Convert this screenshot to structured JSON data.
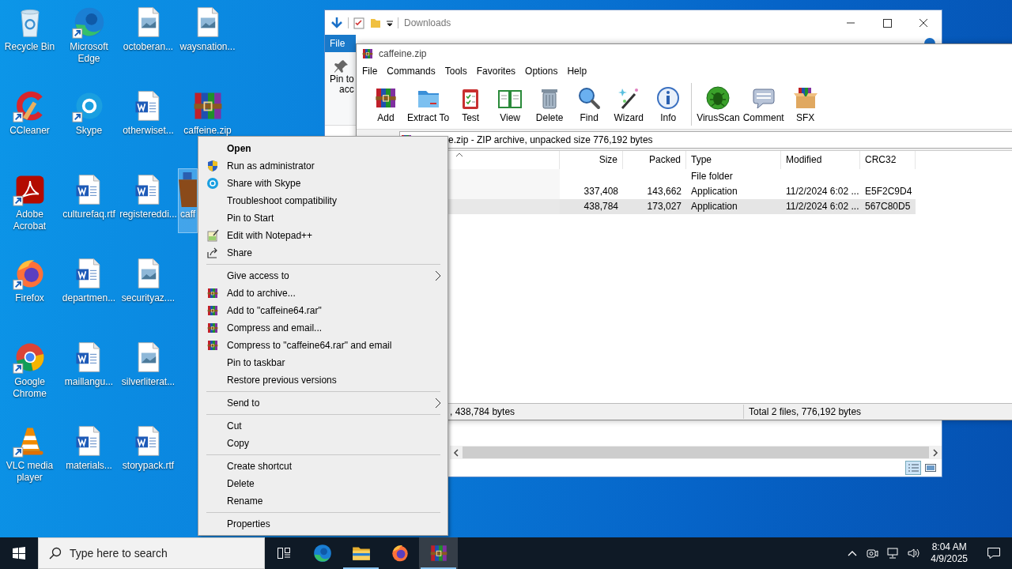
{
  "desktop_icons": [
    {
      "label": "Recycle Bin",
      "kind": "recycle",
      "shortcut": false,
      "selected": false
    },
    {
      "label": "CCleaner",
      "kind": "ccleaner",
      "shortcut": true,
      "selected": false
    },
    {
      "label": "Adobe Acrobat",
      "kind": "acrobat",
      "shortcut": true,
      "selected": false
    },
    {
      "label": "Firefox",
      "kind": "firefox",
      "shortcut": true,
      "selected": false
    },
    {
      "label": "Google Chrome",
      "kind": "chrome",
      "shortcut": true,
      "selected": false
    },
    {
      "label": "VLC media player",
      "kind": "vlc",
      "shortcut": true,
      "selected": false
    },
    {
      "label": "Microsoft Edge",
      "kind": "edge",
      "shortcut": true,
      "selected": false
    },
    {
      "label": "Skype",
      "kind": "skype",
      "shortcut": true,
      "selected": false
    },
    {
      "label": "culturefaq.rtf",
      "kind": "word",
      "shortcut": false,
      "selected": false
    },
    {
      "label": "departmen...",
      "kind": "word",
      "shortcut": false,
      "selected": false
    },
    {
      "label": "maillangu...",
      "kind": "word",
      "shortcut": false,
      "selected": false
    },
    {
      "label": "materials...",
      "kind": "word",
      "shortcut": false,
      "selected": false
    },
    {
      "label": "octoberan...",
      "kind": "image",
      "shortcut": false,
      "selected": false
    },
    {
      "label": "otherwiset...",
      "kind": "word",
      "shortcut": false,
      "selected": false
    },
    {
      "label": "registereddi...",
      "kind": "word",
      "shortcut": false,
      "selected": false
    },
    {
      "label": "securityaz....",
      "kind": "image",
      "shortcut": false,
      "selected": false
    },
    {
      "label": "silverliterat...",
      "kind": "image",
      "shortcut": false,
      "selected": false
    },
    {
      "label": "storypack.rtf",
      "kind": "word",
      "shortcut": false,
      "selected": false
    },
    {
      "label": "waysnation...",
      "kind": "image",
      "shortcut": false,
      "selected": false
    },
    {
      "label": "caffeine.zip",
      "kind": "archive",
      "shortcut": false,
      "selected": false
    },
    {
      "label": "caff",
      "kind": "cup",
      "shortcut": false,
      "selected": true
    }
  ],
  "explorer": {
    "title": "Downloads",
    "ribbon_tab": "File",
    "pin_label": "Pin to",
    "pin_label_cut": "acc"
  },
  "winrar": {
    "title": "caffeine.zip",
    "menu": [
      "File",
      "Commands",
      "Tools",
      "Favorites",
      "Options",
      "Help"
    ],
    "toolbar": [
      {
        "label": "Add",
        "kind": "add"
      },
      {
        "label": "Extract To",
        "kind": "extract"
      },
      {
        "label": "Test",
        "kind": "test"
      },
      {
        "label": "View",
        "kind": "view"
      },
      {
        "label": "Delete",
        "kind": "delete"
      },
      {
        "label": "Find",
        "kind": "find"
      },
      {
        "label": "Wizard",
        "kind": "wizard"
      },
      {
        "label": "Info",
        "kind": "info"
      },
      {
        "label": "VirusScan",
        "kind": "virus"
      },
      {
        "label": "Comment",
        "kind": "comment"
      },
      {
        "label": "SFX",
        "kind": "sfx"
      }
    ],
    "address": "e.zip - ZIP archive, unpacked size 776,192 bytes",
    "columns": [
      {
        "label": "Size",
        "kind": "number"
      },
      {
        "label": "Packed",
        "kind": "number"
      },
      {
        "label": "Type",
        "kind": "text"
      },
      {
        "label": "Modified",
        "kind": "text"
      },
      {
        "label": "CRC32",
        "kind": "text"
      }
    ],
    "rows": [
      {
        "type": "File folder",
        "selected": false
      },
      {
        "size": "337,408",
        "packed": "143,662",
        "type": "Application",
        "modified": "11/2/2024 6:02 ...",
        "crc32": "E5F2C9D4",
        "selected": false
      },
      {
        "size": "438,784",
        "packed": "173,027",
        "type": "Application",
        "modified": "11/2/2024 6:02 ...",
        "crc32": "567C80D5",
        "selected": true
      }
    ],
    "status_left": ", 438,784 bytes",
    "status_right": "Total 2 files, 776,192 bytes"
  },
  "context_menu": [
    {
      "kind": "plain",
      "label": "Open",
      "default": true,
      "submenu": false
    },
    {
      "kind": "shield",
      "label": "Run as administrator",
      "default": false,
      "submenu": false
    },
    {
      "kind": "skype",
      "label": "Share with Skype",
      "default": false,
      "submenu": false
    },
    {
      "kind": "plain",
      "label": "Troubleshoot compatibility",
      "default": false,
      "submenu": false
    },
    {
      "kind": "plain",
      "label": "Pin to Start",
      "default": false,
      "submenu": false
    },
    {
      "kind": "notepad",
      "label": "Edit with Notepad++",
      "default": false,
      "submenu": false
    },
    {
      "kind": "share",
      "label": "Share",
      "default": false,
      "submenu": false
    },
    {
      "kind": "separator"
    },
    {
      "kind": "plain",
      "label": "Give access to",
      "default": false,
      "submenu": true
    },
    {
      "kind": "archive",
      "label": "Add to archive...",
      "default": false,
      "submenu": false
    },
    {
      "kind": "archive",
      "label": "Add to \"caffeine64.rar\"",
      "default": false,
      "submenu": false
    },
    {
      "kind": "archive",
      "label": "Compress and email...",
      "default": false,
      "submenu": false
    },
    {
      "kind": "archive",
      "label": "Compress to \"caffeine64.rar\" and email",
      "default": false,
      "submenu": false
    },
    {
      "kind": "plain",
      "label": "Pin to taskbar",
      "default": false,
      "submenu": false
    },
    {
      "kind": "plain",
      "label": "Restore previous versions",
      "default": false,
      "submenu": false
    },
    {
      "kind": "separator"
    },
    {
      "kind": "plain",
      "label": "Send to",
      "default": false,
      "submenu": true
    },
    {
      "kind": "separator"
    },
    {
      "kind": "plain",
      "label": "Cut",
      "default": false,
      "submenu": false
    },
    {
      "kind": "plain",
      "label": "Copy",
      "default": false,
      "submenu": false
    },
    {
      "kind": "separator"
    },
    {
      "kind": "plain",
      "label": "Create shortcut",
      "default": false,
      "submenu": false
    },
    {
      "kind": "plain",
      "label": "Delete",
      "default": false,
      "submenu": false
    },
    {
      "kind": "plain",
      "label": "Rename",
      "default": false,
      "submenu": false
    },
    {
      "kind": "separator"
    },
    {
      "kind": "plain",
      "label": "Properties",
      "default": false,
      "submenu": false
    }
  ],
  "taskbar": {
    "search_placeholder": "Type here to search",
    "apps": [
      {
        "kind": "edge",
        "running": false,
        "selected": false
      },
      {
        "kind": "folder",
        "running": true,
        "selected": false
      },
      {
        "kind": "firefox",
        "running": false,
        "selected": false
      },
      {
        "kind": "archive",
        "running": true,
        "selected": true
      }
    ],
    "time": "8:04 AM",
    "date": "4/9/2025"
  }
}
